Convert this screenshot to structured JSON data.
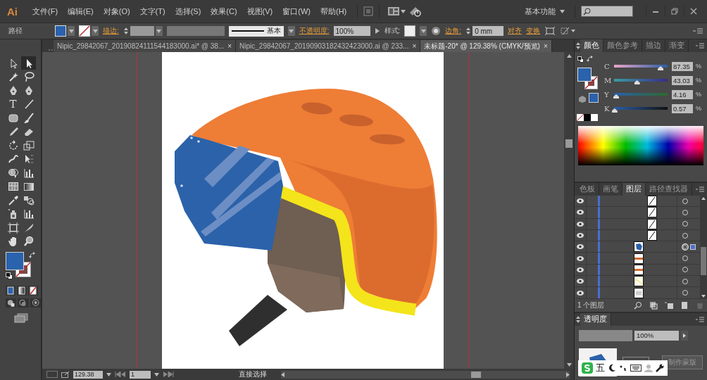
{
  "app": {
    "logo": "Ai",
    "menus": [
      "文件(F)",
      "编辑(E)",
      "对象(O)",
      "文字(T)",
      "选择(S)",
      "效果(C)",
      "视图(V)",
      "窗口(W)",
      "帮助(H)"
    ],
    "workspace": "基本功能"
  },
  "control_bar": {
    "object_type": "路径",
    "stroke_label": "描边:",
    "stroke_profile": "基本",
    "opacity_label": "不透明度:",
    "opacity": "100%",
    "style_label": "样式:",
    "corner_label": "边角:",
    "corner": "0 mm",
    "align": "对齐",
    "transform": "变换"
  },
  "documents": [
    {
      "title": "Nipic_29842067_20190824111544183000.ai* @ 38...",
      "close": "×",
      "selected": false
    },
    {
      "title": "Nipic_29842067_20190903182432423000.ai @ 233...",
      "close": "×",
      "selected": false
    },
    {
      "title": "未标题-20* @ 129.38% (CMYK/预览)",
      "close": "×",
      "selected": true
    }
  ],
  "tools": [
    {
      "kind": "selection",
      "selected": false
    },
    {
      "kind": "direct-selection",
      "selected": true
    },
    {
      "kind": "wand",
      "selected": false
    },
    {
      "kind": "lasso",
      "selected": false
    },
    {
      "kind": "pen",
      "selected": false
    },
    {
      "kind": "pen",
      "selected": false
    },
    {
      "kind": "type",
      "glyph": "T",
      "selected": false
    },
    {
      "kind": "line",
      "selected": false
    },
    {
      "kind": "rectangle",
      "selected": false
    },
    {
      "kind": "brush",
      "selected": false
    },
    {
      "kind": "pencil",
      "selected": false
    },
    {
      "kind": "eraser",
      "selected": false
    },
    {
      "kind": "rotate",
      "selected": false
    },
    {
      "kind": "scale",
      "selected": false
    },
    {
      "kind": "warp",
      "selected": false
    },
    {
      "kind": "free-transform",
      "selected": false
    },
    {
      "kind": "shape-builder",
      "selected": false
    },
    {
      "kind": "graph",
      "selected": false
    },
    {
      "kind": "mesh",
      "selected": false
    },
    {
      "kind": "gradient",
      "selected": false
    },
    {
      "kind": "eyedropper",
      "selected": false
    },
    {
      "kind": "blend",
      "selected": false
    },
    {
      "kind": "sprayer",
      "selected": false
    },
    {
      "kind": "graph",
      "selected": false
    },
    {
      "kind": "artboard",
      "selected": false
    },
    {
      "kind": "slice",
      "selected": false
    },
    {
      "kind": "hand",
      "selected": false
    },
    {
      "kind": "zoom",
      "selected": false
    }
  ],
  "color_panel": {
    "tabs": [
      {
        "label": "颜色",
        "selected": true
      },
      {
        "label": "颜色参考",
        "selected": false
      },
      {
        "label": "描边",
        "selected": false
      },
      {
        "label": "渐变",
        "selected": false
      }
    ],
    "channels": [
      {
        "name": "C",
        "level": 0.87,
        "value": "87.35",
        "unit": "%"
      },
      {
        "name": "M",
        "level": 0.43,
        "value": "43.03",
        "unit": "%"
      },
      {
        "name": "Y",
        "level": 0.04,
        "value": "4.16",
        "unit": "%"
      },
      {
        "name": "K",
        "level": 0.01,
        "value": "0.57",
        "unit": "%"
      }
    ]
  },
  "layers_panel": {
    "tabs": [
      {
        "label": "色板",
        "selected": false
      },
      {
        "label": "画笔",
        "selected": false
      },
      {
        "label": "图层",
        "selected": true
      },
      {
        "label": "路径查找器",
        "selected": false
      }
    ],
    "rows": [
      {
        "kind": "empty",
        "visible": true,
        "selected": false
      },
      {
        "kind": "empty",
        "visible": true,
        "selected": false
      },
      {
        "kind": "empty",
        "visible": true,
        "selected": false
      },
      {
        "kind": "empty",
        "visible": true,
        "selected": false
      },
      {
        "kind": "blue",
        "visible": true,
        "selected": true
      },
      {
        "kind": "orange",
        "visible": true,
        "selected": false
      },
      {
        "kind": "orange",
        "visible": true,
        "selected": false
      },
      {
        "kind": "yellow",
        "visible": true,
        "selected": false
      },
      {
        "kind": "gray",
        "visible": true,
        "selected": false
      }
    ],
    "footer": "1 个图层"
  },
  "transparency_panel": {
    "title": "透明度",
    "opacity": "100%",
    "make_mask": "制作蒙版"
  },
  "ime_bar": {
    "mode": "五"
  },
  "status_bar": {
    "zoom": "129.38",
    "artboard": "1",
    "tool": "直接选择"
  }
}
